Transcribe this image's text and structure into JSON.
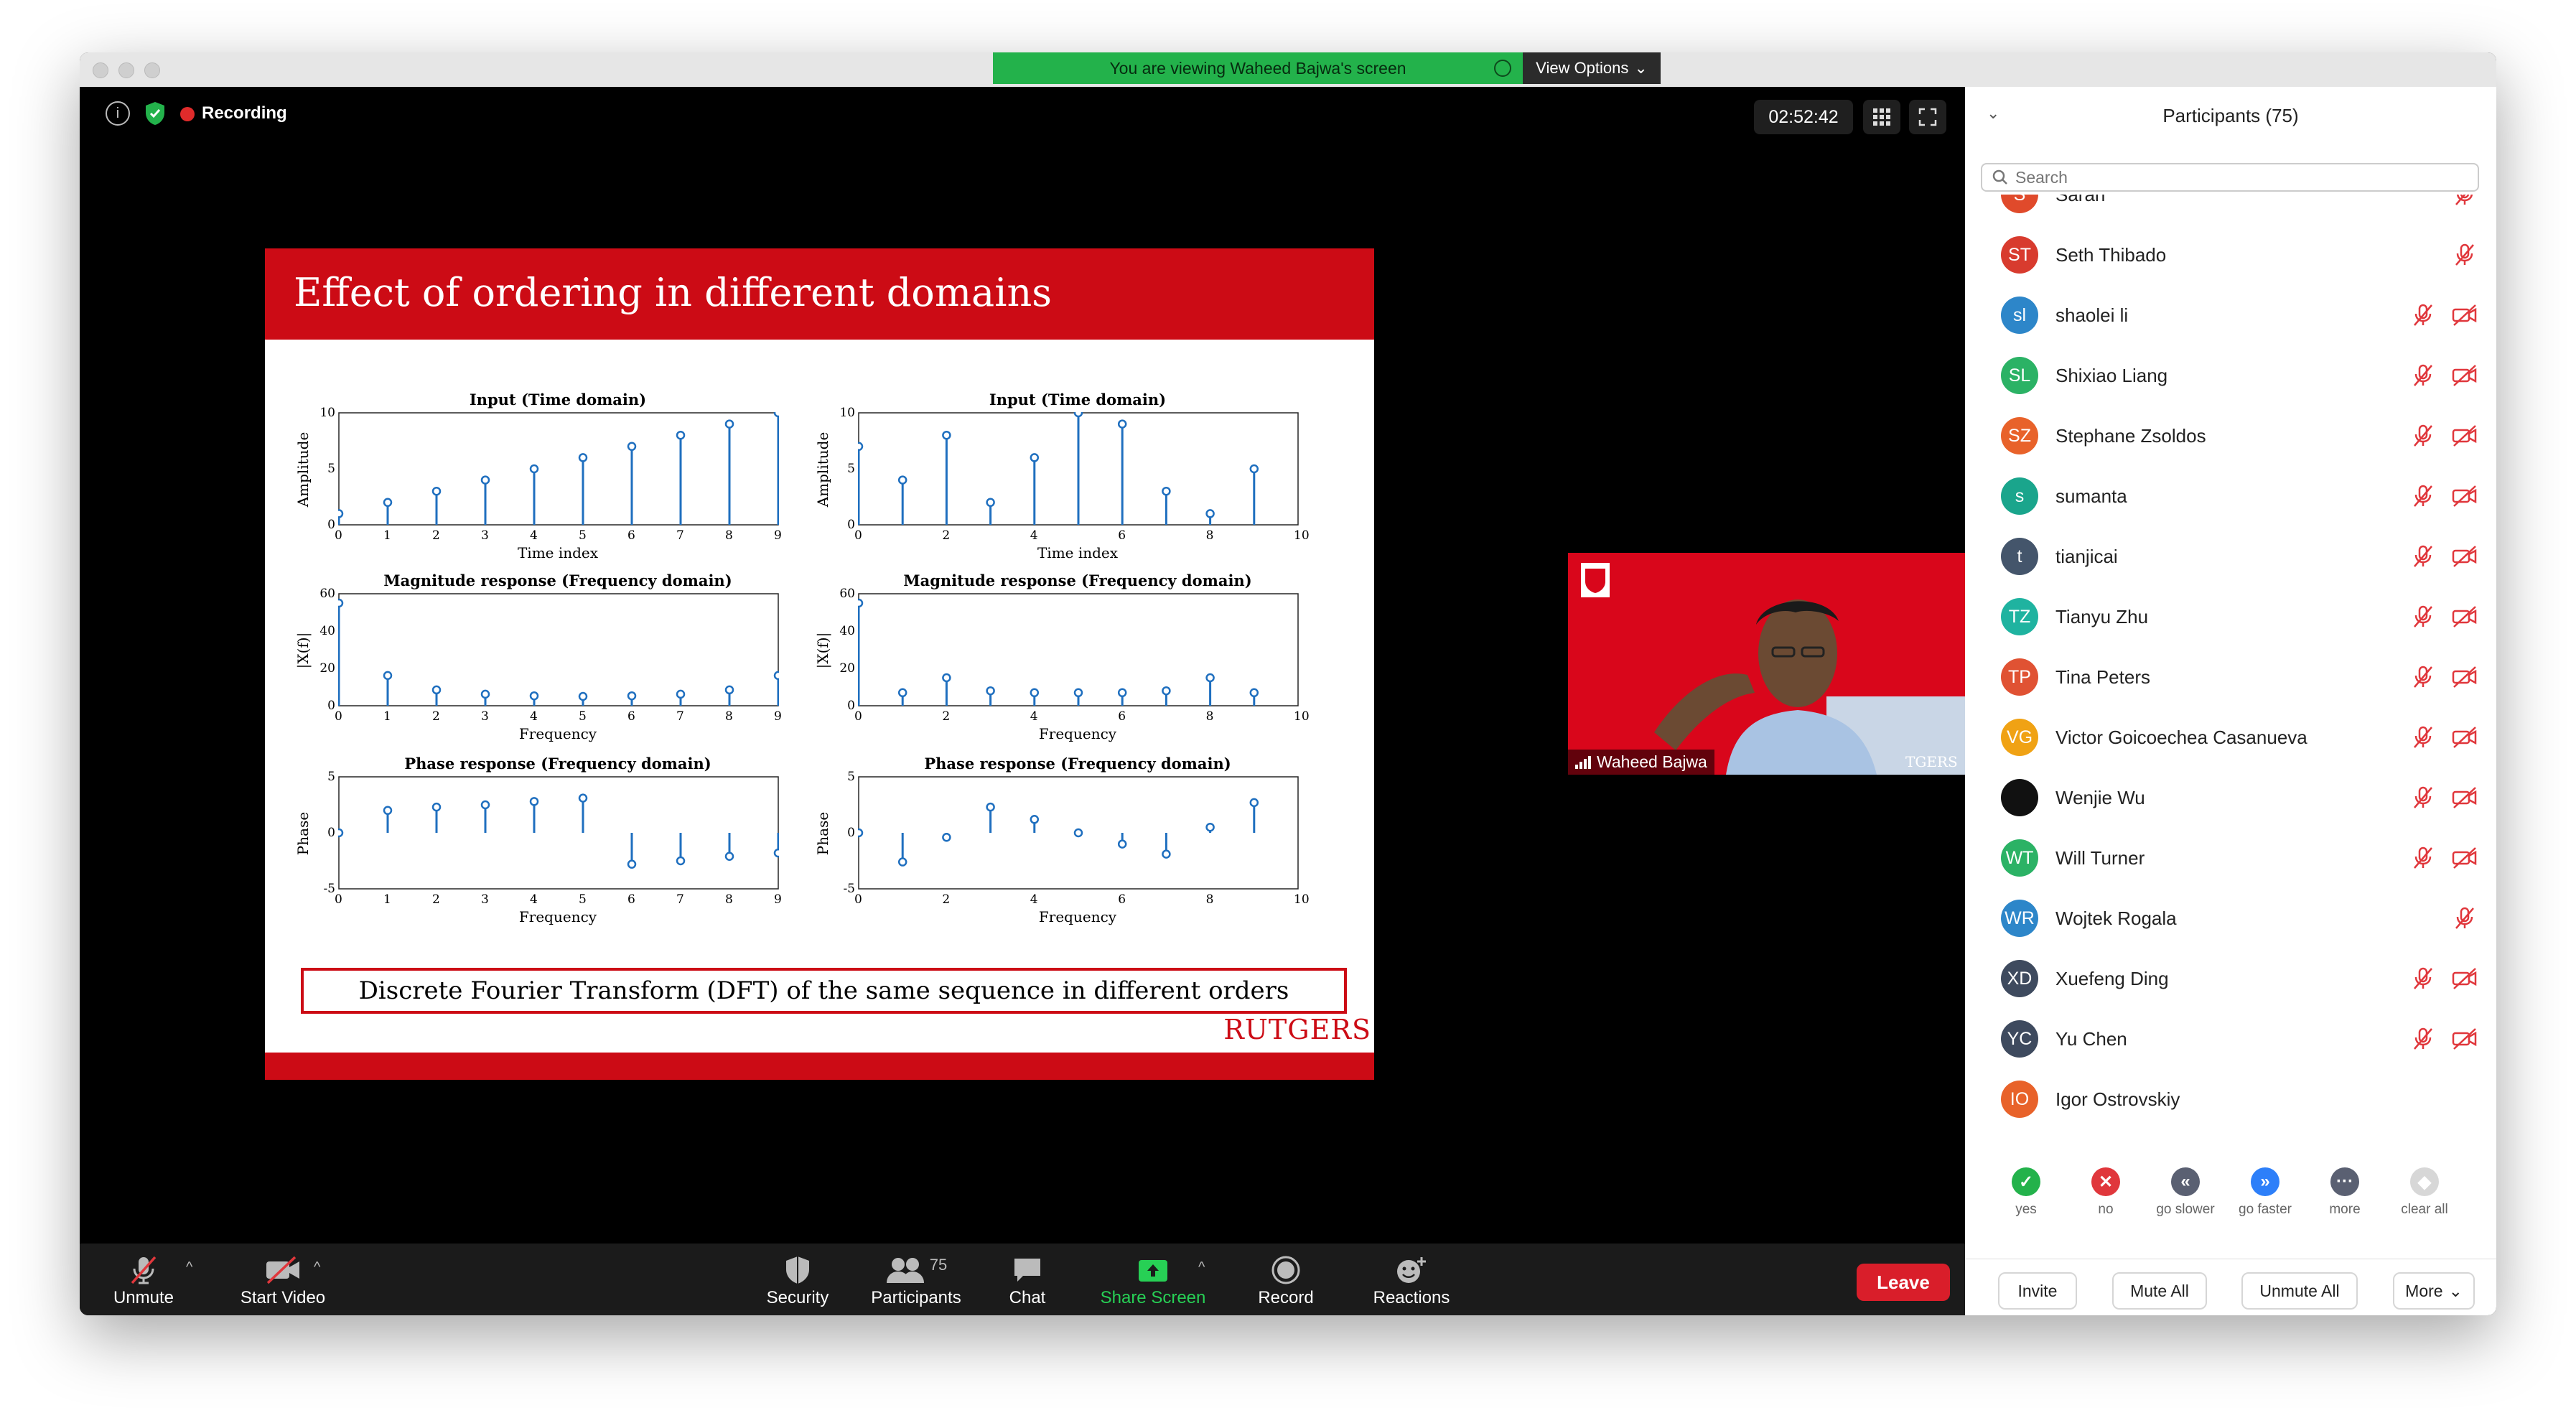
{
  "banner": {
    "viewing_text": "You are viewing Waheed Bajwa's screen",
    "view_options": "View Options"
  },
  "meeting": {
    "recording_label": "Recording",
    "timer": "02:52:42"
  },
  "slide": {
    "title": "Effect of ordering in different domains",
    "caption": "Discrete Fourier Transform (DFT) of the same sequence in different orders",
    "logo": "RUTGERS",
    "plots": [
      {
        "title": "Input (Time domain)",
        "xlabel": "Time index",
        "ylabel": "Amplitude",
        "xticks": [
          "0",
          "1",
          "2",
          "3",
          "4",
          "5",
          "6",
          "7",
          "8",
          "9"
        ],
        "yticks": [
          "0",
          "5",
          "10"
        ],
        "xlim": [
          0,
          9
        ],
        "ylim": [
          0,
          10
        ],
        "x": [
          0,
          1,
          2,
          3,
          4,
          5,
          6,
          7,
          8,
          9
        ],
        "y": [
          1,
          2,
          3,
          4,
          5,
          6,
          7,
          8,
          9,
          10
        ]
      },
      {
        "title": "Input (Time domain)",
        "xlabel": "Time index",
        "ylabel": "Amplitude",
        "xticks": [
          "0",
          "2",
          "4",
          "6",
          "8",
          "10"
        ],
        "yticks": [
          "0",
          "5",
          "10"
        ],
        "xlim": [
          0,
          10
        ],
        "ylim": [
          0,
          10
        ],
        "x": [
          0,
          1,
          2,
          3,
          4,
          5,
          6,
          7,
          8,
          9
        ],
        "y": [
          7,
          4,
          8,
          2,
          6,
          10,
          9,
          3,
          1,
          5
        ]
      },
      {
        "title": "Magnitude response (Frequency domain)",
        "xlabel": "Frequency",
        "ylabel": "|X(f)|",
        "xticks": [
          "0",
          "1",
          "2",
          "3",
          "4",
          "5",
          "6",
          "7",
          "8",
          "9"
        ],
        "yticks": [
          "0",
          "20",
          "40",
          "60"
        ],
        "xlim": [
          0,
          9
        ],
        "ylim": [
          0,
          60
        ],
        "x": [
          0,
          1,
          2,
          3,
          4,
          5,
          6,
          7,
          8,
          9
        ],
        "y": [
          55,
          16.2,
          8.5,
          6.2,
          5.3,
          5,
          5.3,
          6.2,
          8.5,
          16.2
        ]
      },
      {
        "title": "Magnitude response (Frequency domain)",
        "xlabel": "Frequency",
        "ylabel": "|X(f)|",
        "xticks": [
          "0",
          "2",
          "4",
          "6",
          "8",
          "10"
        ],
        "yticks": [
          "0",
          "20",
          "40",
          "60"
        ],
        "xlim": [
          0,
          10
        ],
        "ylim": [
          0,
          60
        ],
        "x": [
          0,
          1,
          2,
          3,
          4,
          5,
          6,
          7,
          8,
          9
        ],
        "y": [
          55,
          7,
          15,
          8,
          7,
          7,
          7,
          8,
          15,
          7
        ]
      },
      {
        "title": "Phase response (Frequency domain)",
        "xlabel": "Frequency",
        "ylabel": "Phase",
        "xticks": [
          "0",
          "1",
          "2",
          "3",
          "4",
          "5",
          "6",
          "7",
          "8",
          "9"
        ],
        "yticks": [
          "-5",
          "0",
          "5"
        ],
        "xlim": [
          0,
          9
        ],
        "ylim": [
          -5,
          5
        ],
        "x": [
          0,
          1,
          2,
          3,
          4,
          5,
          6,
          7,
          8,
          9
        ],
        "y": [
          0,
          2,
          2.3,
          2.5,
          2.8,
          3.1,
          -2.8,
          -2.5,
          -2.1,
          -1.8
        ]
      },
      {
        "title": "Phase response (Frequency domain)",
        "xlabel": "Frequency",
        "ylabel": "Phase",
        "xticks": [
          "0",
          "2",
          "4",
          "6",
          "8",
          "10"
        ],
        "yticks": [
          "-5",
          "0",
          "5"
        ],
        "xlim": [
          0,
          10
        ],
        "ylim": [
          -5,
          5
        ],
        "x": [
          0,
          1,
          2,
          3,
          4,
          5,
          6,
          7,
          8,
          9
        ],
        "y": [
          0,
          -2.6,
          -0.4,
          2.3,
          1.2,
          0,
          -1,
          -1.9,
          0.5,
          2.7
        ]
      }
    ]
  },
  "video": {
    "name": "Waheed Bajwa"
  },
  "toolbar": {
    "unmute": "Unmute",
    "start_video": "Start Video",
    "security": "Security",
    "participants": "Participants",
    "participants_count": "75",
    "chat": "Chat",
    "share_screen": "Share Screen",
    "record": "Record",
    "reactions": "Reactions",
    "leave": "Leave"
  },
  "panel": {
    "title": "Participants (75)",
    "search_placeholder": "Search",
    "participants": [
      {
        "initials": "S",
        "name": "Sarah",
        "color": "#e04a2b",
        "video": false
      },
      {
        "initials": "ST",
        "name": "Seth Thibado",
        "color": "#d83b2e",
        "video": false
      },
      {
        "initials": "sl",
        "name": "shaolei li",
        "color": "#2d86c9",
        "video": true
      },
      {
        "initials": "SL",
        "name": "Shixiao Liang",
        "color": "#2bb265",
        "video": true
      },
      {
        "initials": "SZ",
        "name": "Stephane Zsoldos",
        "color": "#e8622a",
        "video": true
      },
      {
        "initials": "s",
        "name": "sumanta",
        "color": "#1aa58c",
        "video": true
      },
      {
        "initials": "t",
        "name": "tianjicai",
        "color": "#44556b",
        "video": true
      },
      {
        "initials": "TZ",
        "name": "Tianyu Zhu",
        "color": "#1fb3a0",
        "video": true
      },
      {
        "initials": "TP",
        "name": "Tina Peters",
        "color": "#e05233",
        "video": true
      },
      {
        "initials": "VG",
        "name": "Victor Goicoechea Casanueva",
        "color": "#f0a214",
        "video": true
      },
      {
        "initials": "",
        "name": "Wenjie Wu",
        "color": "#111111",
        "video": true
      },
      {
        "initials": "WT",
        "name": "Will Turner",
        "color": "#2bb265",
        "video": true
      },
      {
        "initials": "WR",
        "name": "Wojtek Rogala",
        "color": "#2d86c9",
        "video": false
      },
      {
        "initials": "XD",
        "name": "Xuefeng Ding",
        "color": "#3e4a5e",
        "video": true
      },
      {
        "initials": "YC",
        "name": "Yu Chen",
        "color": "#3e4a5e",
        "video": true
      },
      {
        "initials": "IO",
        "name": "Igor Ostrovskiy",
        "color": "#e8622a",
        "video": null
      }
    ],
    "reactions": [
      {
        "label": "yes",
        "color": "#23b24b",
        "glyph": "✓"
      },
      {
        "label": "no",
        "color": "#e0373c",
        "glyph": "✕"
      },
      {
        "label": "go slower",
        "color": "#5a6072",
        "glyph": "«"
      },
      {
        "label": "go faster",
        "color": "#2d7ff9",
        "glyph": "»"
      },
      {
        "label": "more",
        "color": "#5a6072",
        "glyph": "···"
      },
      {
        "label": "clear all",
        "color": "#d7d7d7",
        "glyph": "◆"
      }
    ],
    "buttons": {
      "invite": "Invite",
      "mute_all": "Mute All",
      "unmute_all": "Unmute All",
      "more": "More"
    }
  }
}
